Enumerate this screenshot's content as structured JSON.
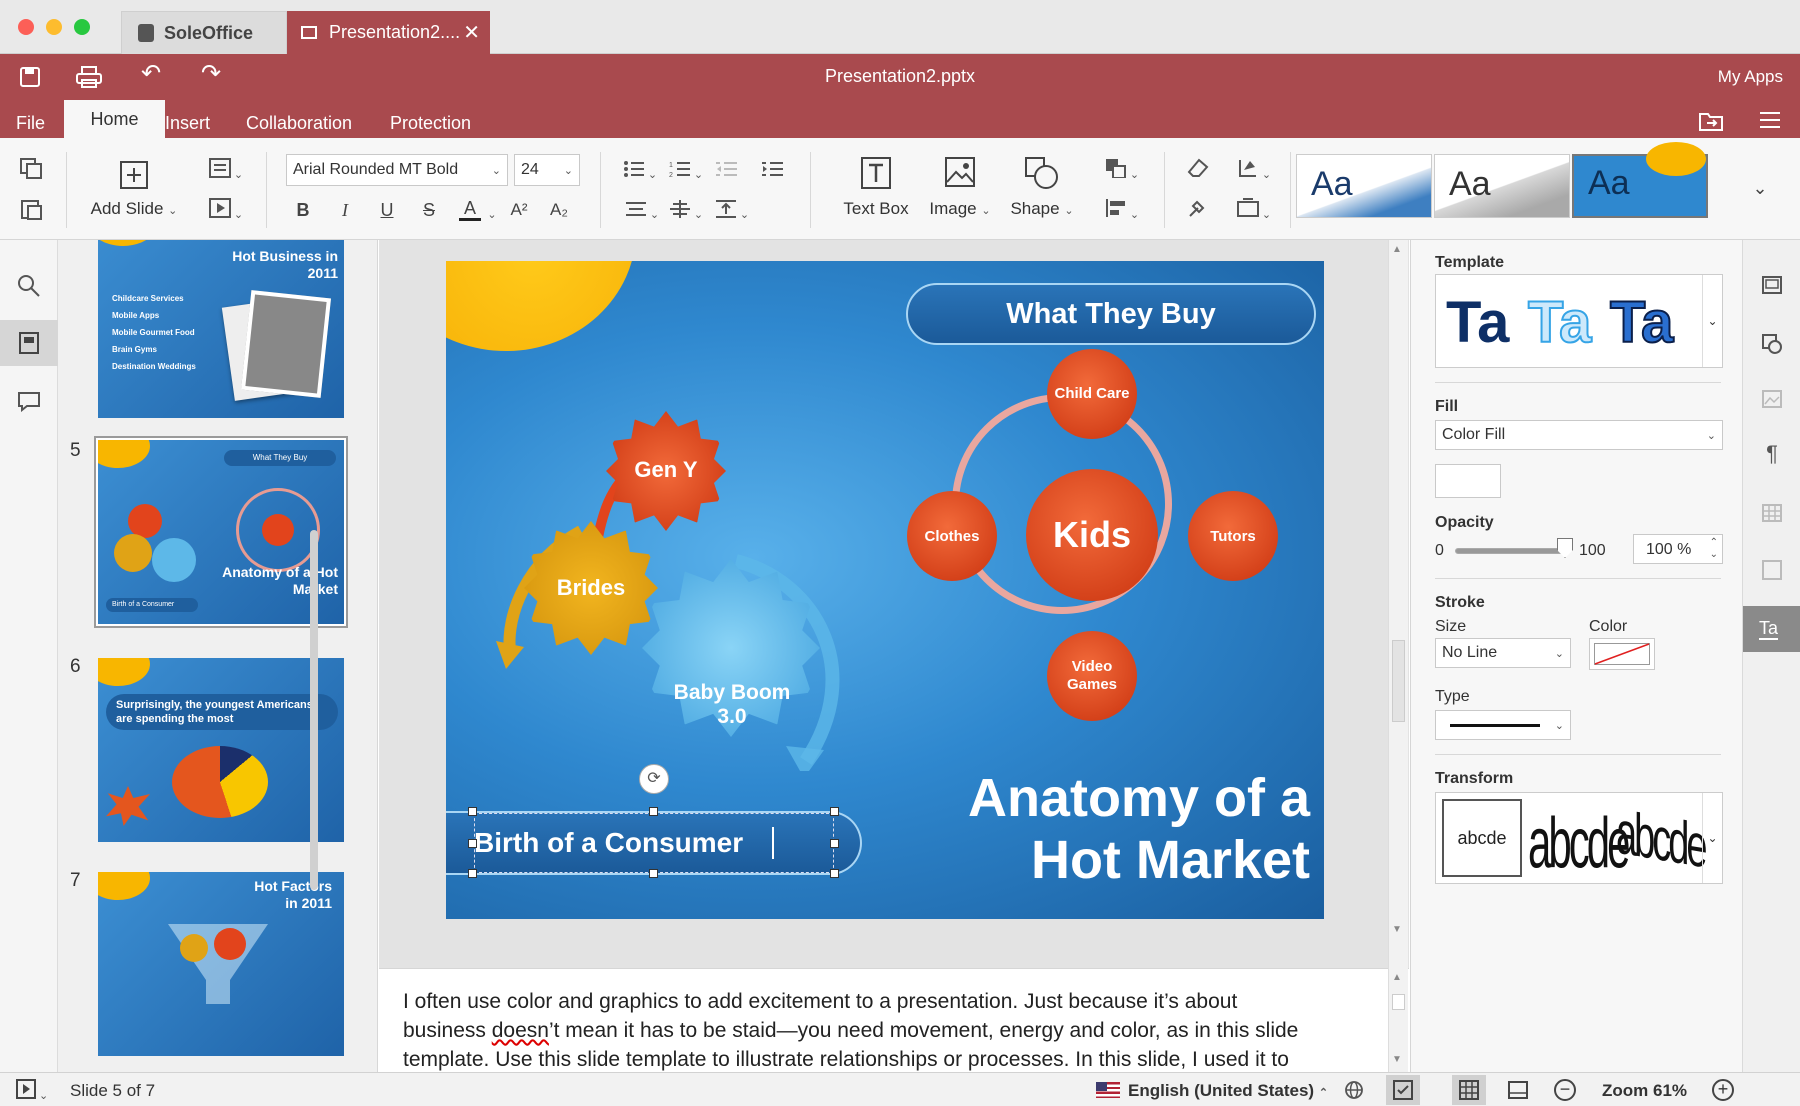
{
  "window": {
    "tab_home": "SoleOffice",
    "tab_doc": "Presentation2....",
    "doc_title": "Presentation2.pptx",
    "my_apps": "My Apps"
  },
  "menu": [
    "File",
    "Home",
    "Insert",
    "Collaboration",
    "Protection"
  ],
  "toolbar": {
    "add_slide": "Add Slide",
    "font_name": "Arial Rounded MT Bold",
    "font_size": "24",
    "text_box": "Text Box",
    "image": "Image",
    "shape": "Shape",
    "bold": "B",
    "italic": "I",
    "underline": "U",
    "strike": "S",
    "font_color": "A",
    "superscript": "A²",
    "subscript": "A₂",
    "theme_sample": "Aa"
  },
  "thumbs": [
    {
      "num": "",
      "title": "Hot Business in 2011",
      "lines": [
        "Childcare Services",
        "Mobile Apps",
        "Mobile Gourmet Food",
        "Brain Gyms",
        "Destination Weddings"
      ]
    },
    {
      "num": "5",
      "title": "What They Buy",
      "subtitle": "Anatomy of a Hot Market",
      "caption": "Birth of a Consumer"
    },
    {
      "num": "6",
      "title": "Surprisingly, the youngest Americans are spending the most"
    },
    {
      "num": "7",
      "title": "Hot Factors in 2011"
    }
  ],
  "slide": {
    "header": "What They Buy",
    "center": "Kids",
    "top": "Child Care",
    "left": "Clothes",
    "right": "Tutors",
    "bottom": "Video Games",
    "gear1": "Gen Y",
    "gear2": "Brides",
    "gear3": "Baby Boom 3.0",
    "caption": "Birth of a Consumer",
    "title1": "Anatomy of a",
    "title2": "Hot Market"
  },
  "notes": {
    "line1": "I often use color and graphics to add excitement to a presentation. Just because it’s about",
    "line2a": "business ",
    "line2b": "doesn",
    "line2c": "’t mean it has to be staid—you need movement, energy and color, as in this slide",
    "line3": "template. Use this slide template to illustrate relationships or processes. In this slide, I used it to"
  },
  "panel": {
    "template": "Template",
    "template_sample": "Ta",
    "fill": "Fill",
    "fill_value": "Color Fill",
    "opacity": "Opacity",
    "opacity_min": "0",
    "opacity_max": "100",
    "opacity_value": "100 %",
    "opacity_level": 1.0,
    "stroke": "Stroke",
    "size": "Size",
    "color": "Color",
    "size_value": "No Line",
    "type": "Type",
    "transform": "Transform",
    "transform_sample": "abcde"
  },
  "status": {
    "slide": "Slide 5 of 7",
    "language": "English (United States)",
    "zoom": "Zoom 61%"
  },
  "colors": {
    "ribbon": "#a94a4e",
    "accent_orange": "#e2441c",
    "slide_blue": "#2f88cf"
  }
}
